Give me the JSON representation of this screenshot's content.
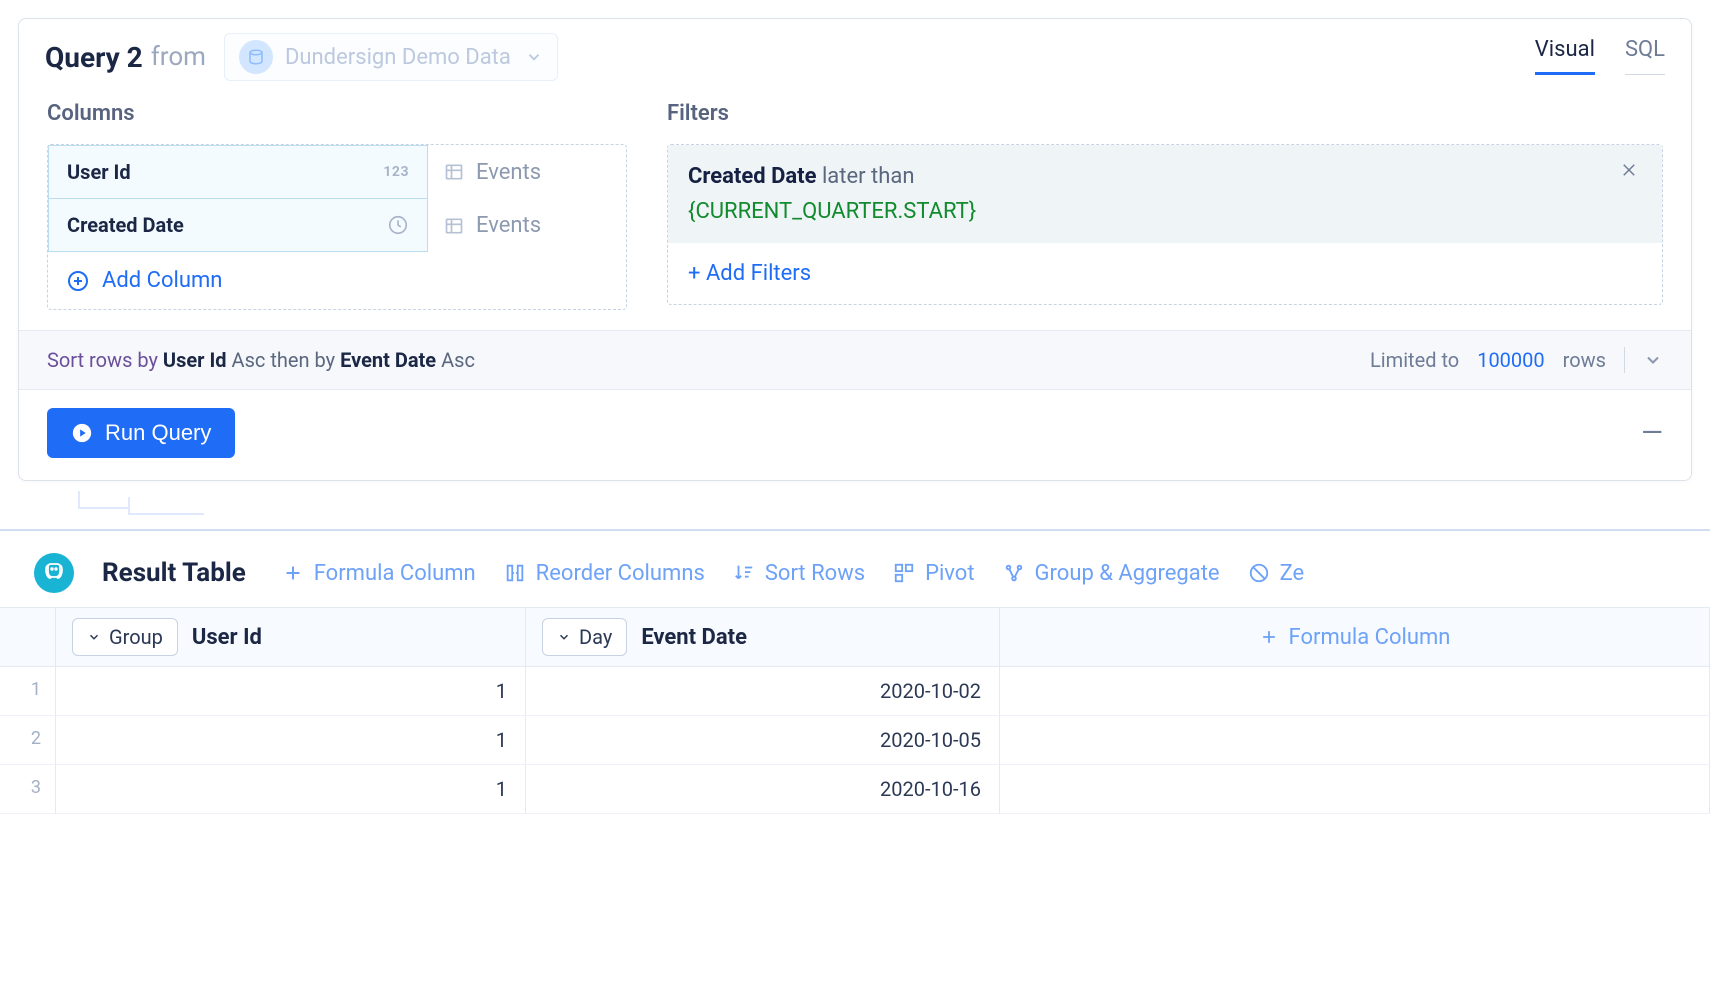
{
  "header": {
    "query_title": "Query 2",
    "from_label": "from",
    "data_source": "Dundersign Demo Data",
    "tabs": {
      "visual": "Visual",
      "sql": "SQL"
    }
  },
  "columns_section": {
    "label": "Columns",
    "items": [
      {
        "name": "User Id",
        "type_badge": "123",
        "source": "Events"
      },
      {
        "name": "Created Date",
        "type_badge": "clock",
        "source": "Events"
      }
    ],
    "add_label": "Add Column"
  },
  "filters_section": {
    "label": "Filters",
    "items": [
      {
        "field": "Created Date",
        "operator": "later than",
        "value": "{CURRENT_QUARTER.START}"
      }
    ],
    "add_label": "+ Add Filters"
  },
  "sort_bar": {
    "lead": "Sort rows by",
    "field1": "User Id",
    "dir1": "Asc",
    "then": "then by",
    "field2": "Event Date",
    "dir2": "Asc",
    "limit_prefix": "Limited to",
    "limit_value": "100000",
    "limit_suffix": "rows"
  },
  "run": {
    "label": "Run Query"
  },
  "result": {
    "title": "Result Table",
    "toolbar": {
      "formula": "Formula Column",
      "reorder": "Reorder Columns",
      "sort": "Sort Rows",
      "pivot": "Pivot",
      "group": "Group & Aggregate",
      "ze": "Ze"
    },
    "columns": {
      "group_pill": "Group",
      "col1_label": "User Id",
      "day_pill": "Day",
      "col2_label": "Event Date",
      "formula_col": "Formula Column"
    },
    "rows": [
      {
        "idx": "1",
        "user_id": "1",
        "event_date": "2020-10-02"
      },
      {
        "idx": "2",
        "user_id": "1",
        "event_date": "2020-10-05"
      },
      {
        "idx": "3",
        "user_id": "1",
        "event_date": "2020-10-16"
      }
    ]
  }
}
